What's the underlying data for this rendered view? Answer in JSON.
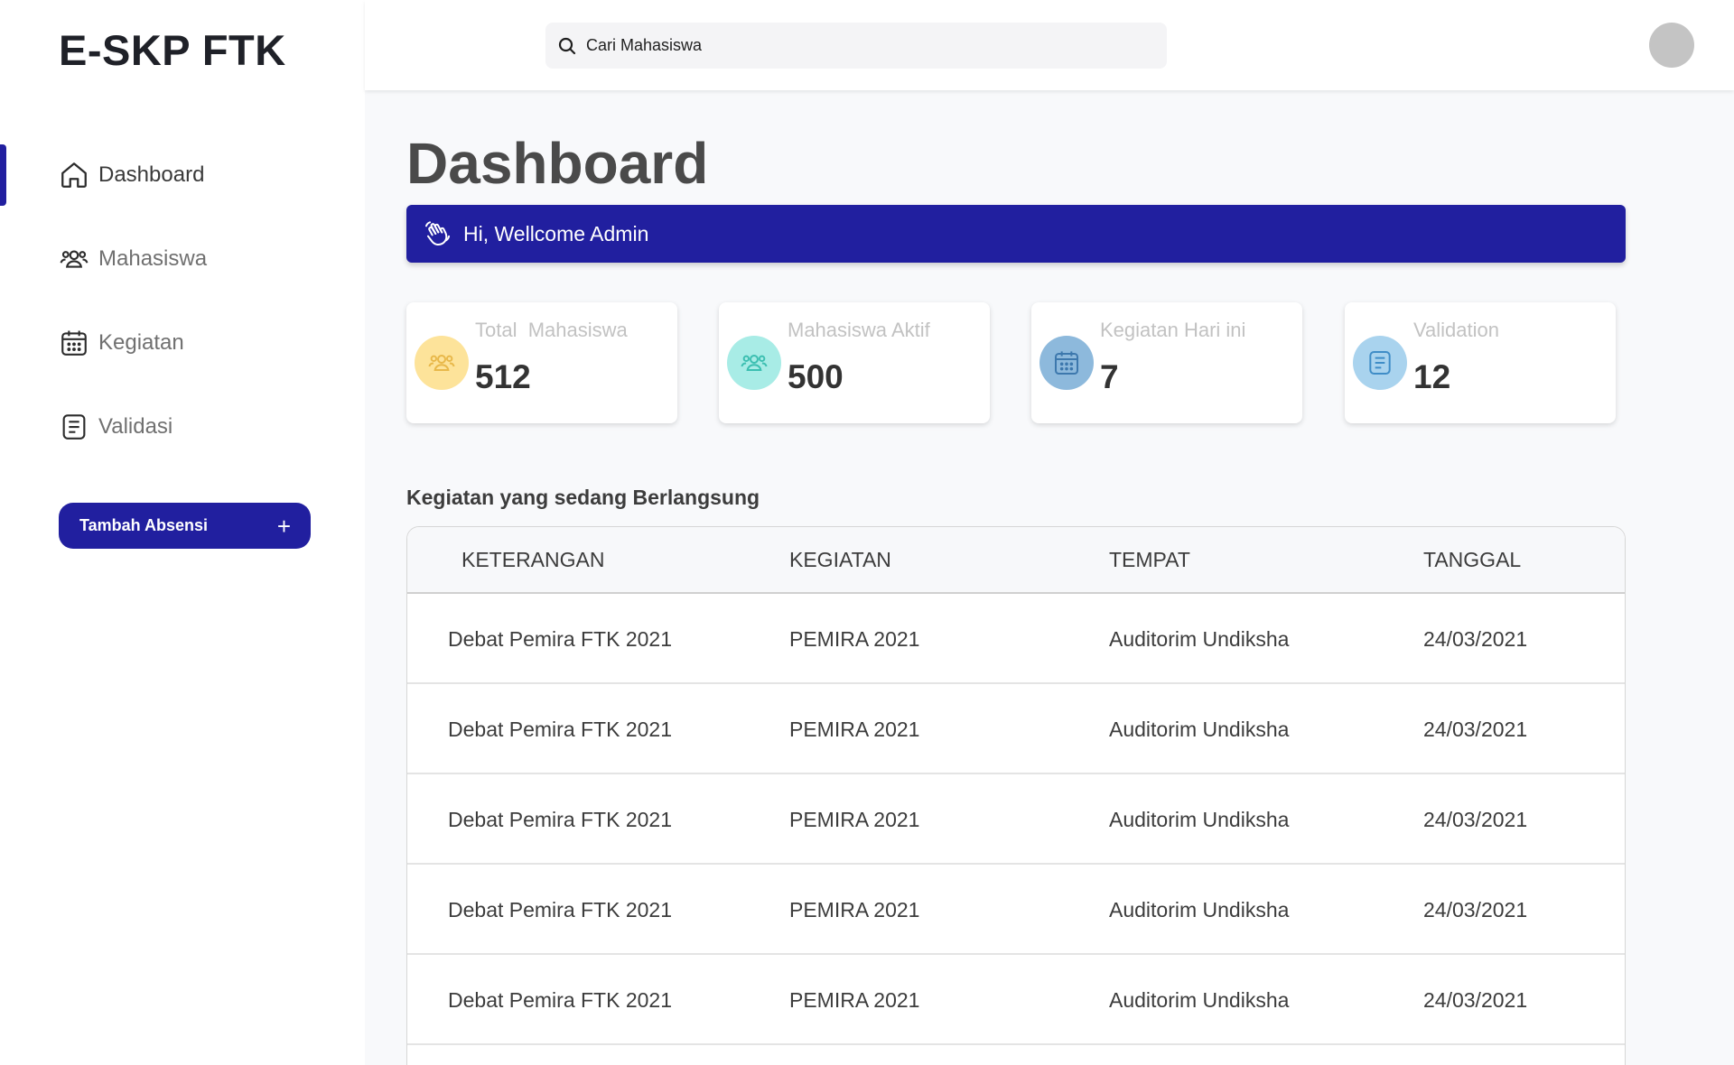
{
  "brand": "E-SKP FTK",
  "search": {
    "placeholder": "Cari Mahasiswa"
  },
  "sidebar": {
    "items": [
      {
        "label": "Dashboard",
        "icon": "home-icon",
        "active": true
      },
      {
        "label": "Mahasiswa",
        "icon": "users-icon",
        "active": false
      },
      {
        "label": "Kegiatan",
        "icon": "calendar-icon",
        "active": false
      },
      {
        "label": "Validasi",
        "icon": "document-icon",
        "active": false
      }
    ],
    "add_button": {
      "label": "Tambah Absensi",
      "icon": "+"
    }
  },
  "main": {
    "title": "Dashboard",
    "welcome": "Hi, Wellcome Admin",
    "stats": [
      {
        "label": "Total  Mahasiswa",
        "value": "512",
        "icon": "users-icon",
        "color": "#fde39a",
        "icon_color": "#e8b84a"
      },
      {
        "label": "Mahasiswa Aktif",
        "value": "500",
        "icon": "users-icon",
        "color": "#a8ece6",
        "icon_color": "#3cbfb1"
      },
      {
        "label": "Kegiatan Hari ini",
        "value": "7",
        "icon": "calendar-icon",
        "color": "#8db9dc",
        "icon_color": "#3d78ad"
      },
      {
        "label": "Validation",
        "value": "12",
        "icon": "document-icon",
        "color": "#a9d3ee",
        "icon_color": "#3f8dc7"
      }
    ],
    "section_title": "Kegiatan yang sedang Berlangsung",
    "table": {
      "headers": [
        "KETERANGAN",
        "KEGIATAN",
        "TEMPAT",
        "TANGGAL"
      ],
      "rows": [
        [
          "Debat Pemira FTK 2021",
          "PEMIRA 2021",
          "Auditorim Undiksha",
          "24/03/2021"
        ],
        [
          "Debat Pemira FTK 2021",
          "PEMIRA 2021",
          "Auditorim Undiksha",
          "24/03/2021"
        ],
        [
          "Debat Pemira FTK 2021",
          "PEMIRA 2021",
          "Auditorim Undiksha",
          "24/03/2021"
        ],
        [
          "Debat Pemira FTK 2021",
          "PEMIRA 2021",
          "Auditorim Undiksha",
          "24/03/2021"
        ],
        [
          "Debat Pemira FTK 2021",
          "PEMIRA 2021",
          "Auditorim Undiksha",
          "24/03/2021"
        ]
      ]
    }
  },
  "colors": {
    "accent": "#211f9f"
  }
}
